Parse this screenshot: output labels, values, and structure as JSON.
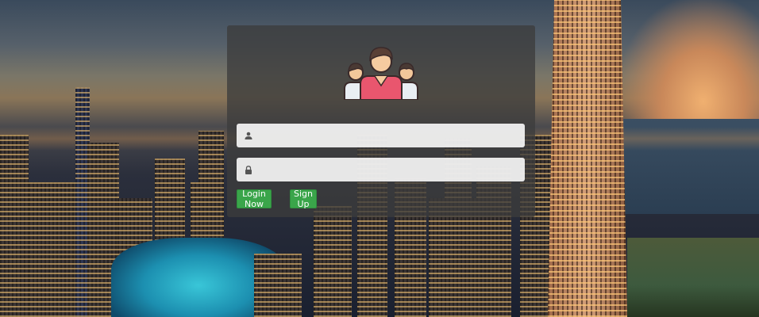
{
  "login": {
    "username_placeholder": "",
    "password_placeholder": "",
    "login_label": "Login Now",
    "signup_label": "Sign Up"
  },
  "icons": {
    "logo": "user-group-icon",
    "username": "user-icon",
    "password": "lock-icon"
  },
  "colors": {
    "button": "#3aa54a",
    "panel": "rgba(60,60,60,0.78)",
    "avatar_shirt": "#e9566e"
  }
}
